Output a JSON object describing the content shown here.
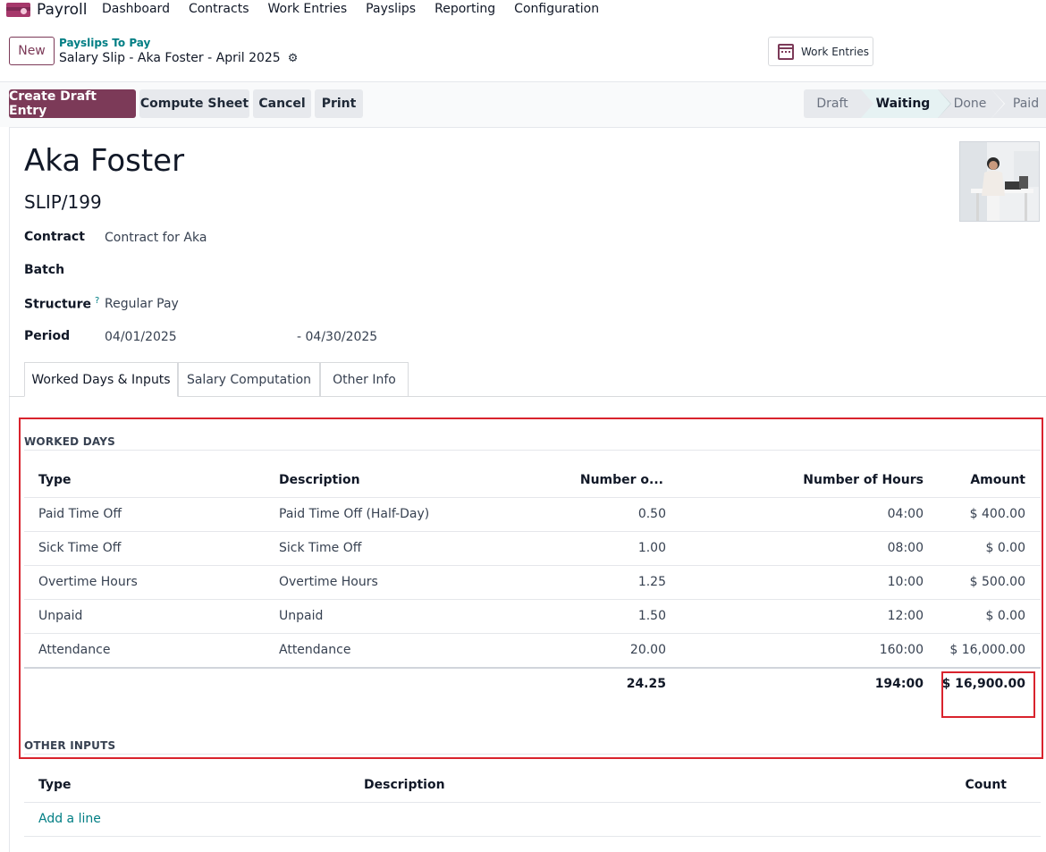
{
  "app": {
    "name": "Payroll",
    "icon": "payroll-app-icon"
  },
  "nav": {
    "items": [
      "Dashboard",
      "Contracts",
      "Work Entries",
      "Payslips",
      "Reporting",
      "Configuration"
    ]
  },
  "control": {
    "new_label": "New",
    "breadcrumb_parent": "Payslips To Pay",
    "breadcrumb_current": "Salary Slip - Aka Foster - April 2025",
    "work_entries_label": "Work Entries"
  },
  "actions": {
    "create_draft": "Create Draft Entry",
    "compute": "Compute Sheet",
    "cancel": "Cancel",
    "print": "Print"
  },
  "stages": [
    "Draft",
    "Waiting",
    "Done",
    "Paid"
  ],
  "stage_active": "Waiting",
  "record": {
    "employee": "Aka Foster",
    "number": "SLIP/199",
    "fields": {
      "contract_label": "Contract",
      "contract_value": "Contract for Aka",
      "batch_label": "Batch",
      "batch_value": "",
      "structure_label": "Structure",
      "structure_help": "?",
      "structure_value": "Regular Pay",
      "period_label": "Period",
      "period_from": "04/01/2025",
      "period_to": "- 04/30/2025"
    }
  },
  "tabs": [
    "Worked Days & Inputs",
    "Salary Computation",
    "Other Info"
  ],
  "worked_days": {
    "title": "WORKED DAYS",
    "headers": [
      "Type",
      "Description",
      "Number o...",
      "Number of Hours",
      "Amount"
    ],
    "rows": [
      [
        "Paid Time Off",
        "Paid Time Off (Half-Day)",
        "0.50",
        "04:00",
        "$ 400.00"
      ],
      [
        "Sick Time Off",
        "Sick Time Off",
        "1.00",
        "08:00",
        "$ 0.00"
      ],
      [
        "Overtime Hours",
        "Overtime Hours",
        "1.25",
        "10:00",
        "$ 500.00"
      ],
      [
        "Unpaid",
        "Unpaid",
        "1.50",
        "12:00",
        "$ 0.00"
      ],
      [
        "Attendance",
        "Attendance",
        "20.00",
        "160:00",
        "$ 16,000.00"
      ]
    ],
    "totals": {
      "days": "24.25",
      "hours": "194:00",
      "amount": "$ 16,900.00"
    }
  },
  "other_inputs": {
    "title": "OTHER INPUTS",
    "headers": [
      "Type",
      "Description",
      "Count"
    ],
    "add_line": "Add a line"
  }
}
